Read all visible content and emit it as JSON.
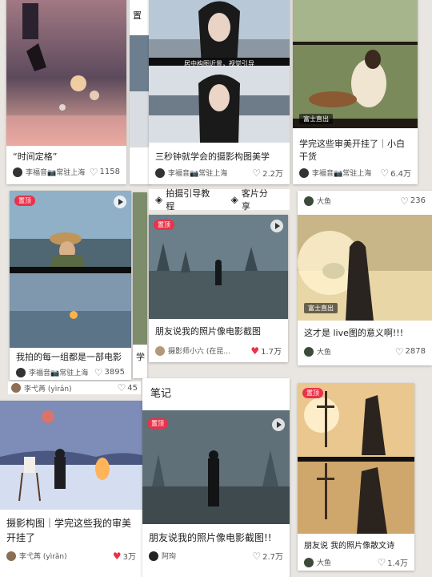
{
  "tabs": {
    "tab1": {
      "icon": "layers-icon",
      "label": "拍摄引导教程"
    },
    "tab2": {
      "icon": "layers-icon",
      "label": "客片分享"
    }
  },
  "section_heading": "笔记",
  "cards": {
    "c1": {
      "title": "“时间定格”",
      "author": "李福音📷常驻上海",
      "likes": "1158",
      "liked": false
    },
    "c2": {
      "title": "置",
      "author": "",
      "likes": "",
      "liked": false
    },
    "c3": {
      "title": "三秒钟就学会的摄影构图美学",
      "author": "李福音📷常驻上海",
      "likes": "2.2万",
      "liked": false,
      "caption": "居中构图近景，视觉引导"
    },
    "c4": {
      "title": "学完这些审美开挂了｜小白干货",
      "author": "李福音📷常驻上海",
      "likes": "6.4万",
      "liked": false,
      "badge": "富士直出"
    },
    "c5": {
      "title": "我拍的每一组都是一部电影",
      "author": "李福音📷常驻上海",
      "likes": "3895",
      "liked": false,
      "pin": "置顶"
    },
    "c6": {
      "title": "朋友说我的照片像电影截图",
      "author": "摄影师小六 (在昆...",
      "likes": "1.7万",
      "liked": true,
      "pin": "置顶"
    },
    "c7": {
      "title": "这才是 live图的意义啊!!!",
      "author": "大鱼",
      "likes": "2878",
      "liked": false,
      "badge": "富士直出",
      "top_author": "大鱼",
      "top_likes": "236"
    },
    "c8": {
      "title": "学",
      "author": "李弋苒 (yìrǎn)",
      "likes": "45",
      "liked": false
    },
    "c9": {
      "title": "摄影构图｜学完这些我的审美开挂了",
      "author": "李弋苒 (yìrǎn)",
      "likes": "3万",
      "liked": true
    },
    "c10": {
      "title": "朋友说我的照片像电影截图!!",
      "author": "阿珣",
      "likes": "2.7万",
      "liked": false,
      "pin": "置顶"
    },
    "c11": {
      "title": "朋友说 我的照片像散文诗",
      "author": "大鱼",
      "likes": "1.4万",
      "liked": false,
      "pin": "置顶"
    }
  },
  "colors": {
    "accent": "#e8334a",
    "background": "#e9e6e2"
  }
}
